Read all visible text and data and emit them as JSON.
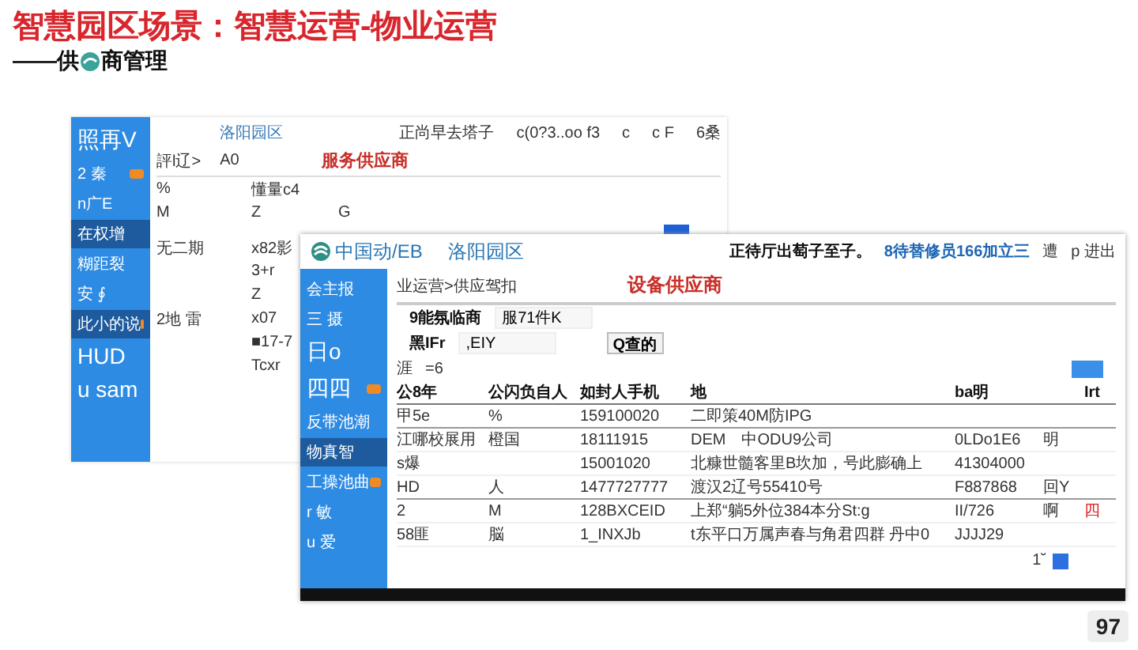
{
  "slide": {
    "title": "智慧园区场景：智慧运营-物业运营",
    "subtitle_start": "——供",
    "subtitle_end": "商管理",
    "page_number": "97"
  },
  "back_window": {
    "park_name": "洛阳园区",
    "header_items": [
      "正尚早去塔子",
      "c(0?3..oo f3",
      "c",
      "c F",
      "6桑"
    ],
    "breadcrumb": "評l辽>",
    "breadcrumb_value": "A0",
    "callout": "服务供应商",
    "sidebar_items": [
      {
        "label": "照再V",
        "kind": "large",
        "selected": false,
        "badge": false
      },
      {
        "label": "2 秦",
        "kind": "normal",
        "selected": false,
        "badge": true
      },
      {
        "label": "n广E",
        "kind": "normal",
        "selected": false,
        "badge": false
      },
      {
        "label": "在权增",
        "kind": "normal",
        "selected": true,
        "badge": false
      },
      {
        "label": "糊距裂",
        "kind": "normal",
        "selected": false,
        "badge": false
      },
      {
        "label": "安 ∮",
        "kind": "normal",
        "selected": false,
        "badge": false
      },
      {
        "label": "此小的说",
        "kind": "normal",
        "selected": true,
        "badge": true
      },
      {
        "label": "HUD",
        "kind": "large",
        "selected": false,
        "badge": false
      },
      {
        "label": "u sam",
        "kind": "large",
        "selected": false,
        "badge": false
      }
    ],
    "rows": [
      {
        "column_1": "%",
        "column_2": "懂量c4"
      },
      {
        "column_1": "M",
        "column_2": "Z",
        "column_3": "G"
      },
      {
        "column_1": "无二期",
        "column_2": "x82影"
      },
      {
        "column_2": "3+r"
      },
      {
        "column_2": "Z"
      },
      {
        "column_1": "2地 雷",
        "column_2": "x07"
      },
      {
        "column_2": "■17-7"
      },
      {
        "column_2": "Tcxr"
      }
    ]
  },
  "front_window": {
    "brand": "中国动/EB",
    "park_name": "洛阳园区",
    "header_items": [
      "正待厅出萄子至子。",
      "8待替修员166加立三",
      "遭",
      "p 进出"
    ],
    "sidebar_items": [
      {
        "label": "会主报",
        "kind": "normal",
        "selected": false,
        "badge": false
      },
      {
        "label": "三 摄",
        "kind": "normal",
        "selected": false,
        "badge": false
      },
      {
        "label": "日o",
        "kind": "large",
        "selected": false,
        "badge": false
      },
      {
        "label": "四四",
        "kind": "large",
        "selected": false,
        "badge": true
      },
      {
        "label": "反带池潮",
        "kind": "normal",
        "selected": false,
        "badge": false
      },
      {
        "label": "物真智",
        "kind": "normal",
        "selected": true,
        "badge": false
      },
      {
        "label": "工操池曲",
        "kind": "normal",
        "selected": false,
        "badge": true
      },
      {
        "label": "r 敏",
        "kind": "normal",
        "selected": false,
        "badge": false
      },
      {
        "label": "u 爱",
        "kind": "normal",
        "selected": false,
        "badge": false
      }
    ],
    "breadcrumb": "业运营>供应驾扣",
    "callout": "设备供应商",
    "filters": [
      {
        "label": "9能氛临商",
        "value": "服71件K"
      },
      {
        "label": "黑IFr",
        "value": ",EIY"
      }
    ],
    "search_button": "Q查的",
    "count_label": "涯",
    "count_value": "=6",
    "columns": [
      "公8年",
      "公闪负自人",
      "如封人手机",
      "地",
      "ba明",
      "Irt"
    ],
    "rows": [
      {
        "column_1": "甲5e",
        "column_2": "%",
        "column_3": "159100020",
        "column_4": "二即策40M防IPG",
        "group_end": true
      },
      {
        "column_1": "江哪校展用",
        "column_2": "橙国",
        "column_3": "18111915",
        "column_4": "DEM　中ODU9公司",
        "column_5": "0LDo1E6",
        "column_6": "明",
        "group_end": false
      },
      {
        "column_1": "s爆",
        "column_3": "15001020",
        "column_4": "北糠世髓客里B坎加，号此膨确上",
        "column_5": "41304000",
        "group_end": false
      },
      {
        "column_1": "HD",
        "column_2": "人",
        "column_3": "1477727777",
        "column_4": "渡汉2辽号55410号",
        "column_5": "F887868",
        "column_6": "回Y",
        "group_end": true
      },
      {
        "column_1": "2",
        "column_2": "M",
        "column_3": "128BXCEID",
        "column_4": "上郑“躺5外位384本分St:g",
        "column_5": "II/726",
        "column_6": "啊",
        "column_7": "四",
        "group_end": false
      },
      {
        "column_1": "58匪",
        "column_2": "脳",
        "column_3": "1_INXJb",
        "column_4": "t东平口万属声春与角君四群 丹中0",
        "column_5": "JJJJ29",
        "group_end": false
      }
    ],
    "pagination": "1˘"
  }
}
